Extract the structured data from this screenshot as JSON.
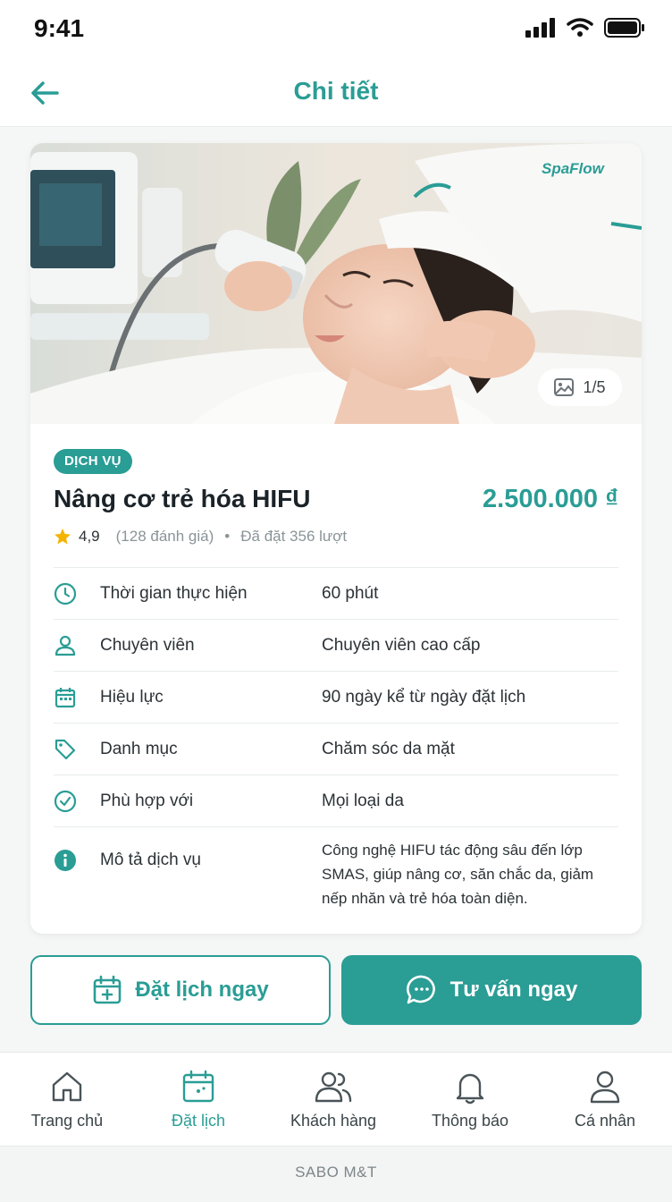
{
  "status_bar": {
    "time": "9:41"
  },
  "header": {
    "title": "Chi tiết"
  },
  "hero": {
    "brand": "SpaFlow",
    "image_counter": "1/5"
  },
  "service": {
    "badge": "DỊCH VỤ",
    "name": "Nâng cơ trẻ hóa HIFU",
    "price": "2.500.000 ₫",
    "rating": "4,9",
    "reviews": "(128 đánh giá)",
    "booked": "Đã đặt 356 lượt"
  },
  "details": [
    {
      "icon": "clock-icon",
      "label": "Thời gian thực hiện",
      "value": "60 phút"
    },
    {
      "icon": "user-icon",
      "label": "Chuyên viên",
      "value": "Chuyên viên cao cấp"
    },
    {
      "icon": "calendar-icon",
      "label": "Hiệu lực",
      "value": "90 ngày kể từ ngày đặt lịch"
    },
    {
      "icon": "tag-icon",
      "label": "Danh mục",
      "value": "Chăm sóc da mặt"
    },
    {
      "icon": "check-circle-icon",
      "label": "Phù hợp với",
      "value": "Mọi loại da"
    },
    {
      "icon": "info-icon",
      "label": "Mô tả dịch vụ",
      "value": "Công nghệ HIFU tác động sâu đến lớp SMAS, giúp nâng cơ, săn chắc da, giảm nếp nhăn và trẻ hóa toàn diện."
    }
  ],
  "actions": {
    "book": "Đặt lịch ngay",
    "consult": "Tư vấn ngay"
  },
  "nav": [
    {
      "label": "Trang chủ",
      "icon": "home-icon"
    },
    {
      "label": "Đặt lịch",
      "icon": "calendar-icon",
      "active": true
    },
    {
      "label": "Khách hàng",
      "icon": "users-icon"
    },
    {
      "label": "Thông báo",
      "icon": "bell-icon"
    },
    {
      "label": "Cá nhân",
      "icon": "person-icon"
    }
  ],
  "footer": {
    "text": "SABO M&T"
  },
  "colors": {
    "primary": "#2a9d95",
    "star": "#f5b301"
  }
}
